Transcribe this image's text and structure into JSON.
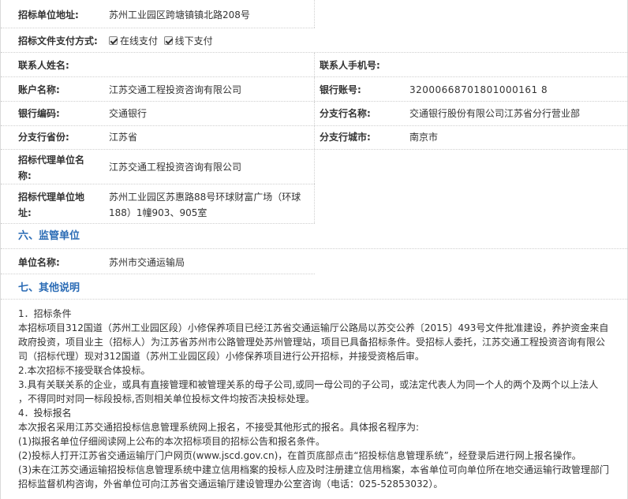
{
  "fields": {
    "address_label": "招标单位地址:",
    "address_value": "苏州工业园区跨塘镇镇北路208号",
    "payment_label": "招标文件支付方式:",
    "pay_online": "在线支付",
    "pay_offline": "线下支付",
    "contact_name_label": "联系人姓名:",
    "contact_phone_label": "联系人手机号:",
    "account_name_label": "账户名称:",
    "account_name_value": "江苏交通工程投资咨询有限公司",
    "bank_account_label": "银行账号:",
    "bank_account_value": "32000668701801000161 8",
    "bank_code_label": "银行编码:",
    "bank_code_value": "交通银行",
    "branch_name_label": "分支行名称:",
    "branch_name_value": "交通银行股份有限公司江苏省分行营业部",
    "branch_province_label": "分支行省份:",
    "branch_province_value": "江苏省",
    "branch_city_label": "分支行城市:",
    "branch_city_value": "南京市",
    "agent_name_label_1": "招标代理单位名",
    "agent_name_label_2": "称:",
    "agent_name_value": "江苏交通工程投资咨询有限公司",
    "agent_addr_label_1": "招标代理单位地",
    "agent_addr_label_2": "址:",
    "agent_addr_value_1": "苏州工业园区苏惠路88号环球财富广场（环球",
    "agent_addr_value_2": "188）1幢903、905室"
  },
  "section6": {
    "title": "六、监管单位",
    "unit_label": "单位名称:",
    "unit_value": "苏州市交通运输局"
  },
  "section7": {
    "title": "七、其他说明",
    "lines": [
      "1．招标条件",
      "本招标项目312国道（苏州工业园区段）小修保养项目已经江苏省交通运输厅公路局以苏交公养〔2015〕493号文件批准建设，养护资金来自",
      "政府投资，项目业主（招标人）为江苏省苏州市公路管理处苏州管理站，项目已具备招标条件。受招标人委托，江苏交通工程投资咨询有限公",
      "司（招标代理）现对312国道（苏州工业园区段）小修保养项目进行公开招标，并接受资格后审。",
      "2.本次招标不接受联合体投标。",
      "3.具有关联关系的企业，或具有直接管理和被管理关系的母子公司,或同一母公司的子公司，或法定代表人为同一个人的两个及两个以上法人",
      "，不得同时对同一标段投标,否则相关单位投标文件均按否决投标处理。",
      "4．投标报名",
      "本次报名采用江苏交通招投标信息管理系统网上报名，不接受其他形式的报名。具体报名程序为:",
      "(1)拟报名单位仔细阅读网上公布的本次招标项目的招标公告和报名条件。",
      "(2)投标人打开江苏省交通运输厅门户网页(www.jscd.gov.cn)，在首页底部点击“招投标信息管理系统”，经登录后进行网上报名操作。",
      "(3)未在江苏交通运输招投标信息管理系统中建立信用档案的投标人应及时注册建立信用档案，本省单位可向单位所在地交通运输行政管理部门",
      "招标监督机构咨询，外省单位可向江苏省交通运输厅建设管理办公室咨询（电话：025-52853032）。"
    ]
  }
}
